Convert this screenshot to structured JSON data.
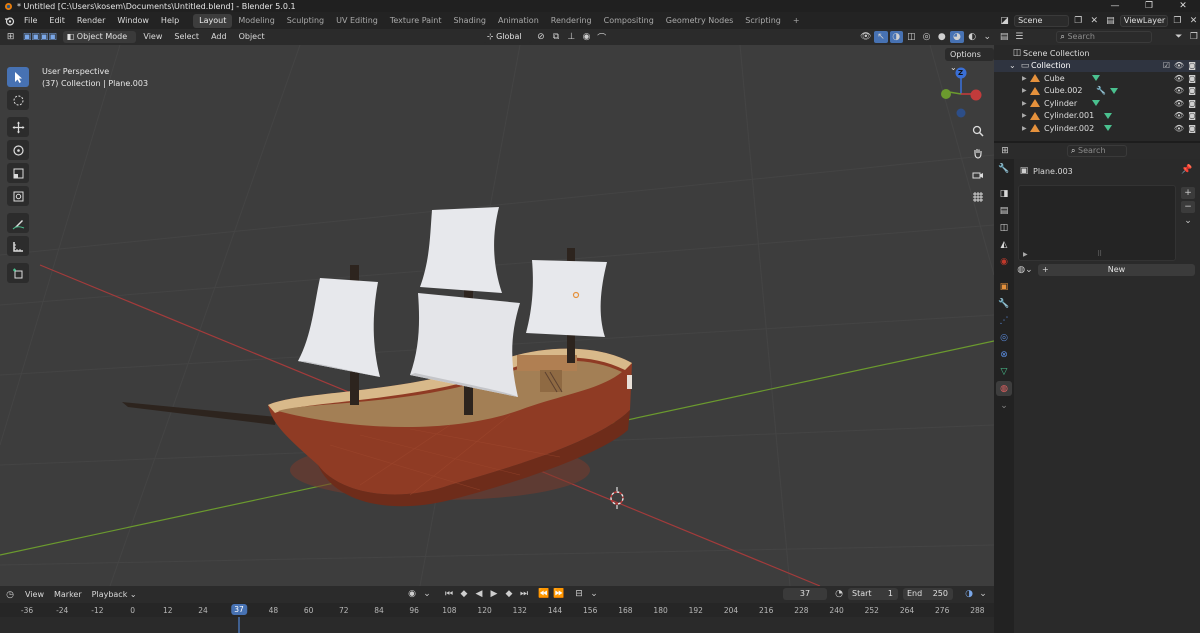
{
  "window": {
    "title": "* Untitled [C:\\Users\\kosem\\Documents\\Untitled.blend] - Blender 5.0.1",
    "controls": [
      "—",
      "❐",
      "✕"
    ]
  },
  "menu": [
    "File",
    "Edit",
    "Render",
    "Window",
    "Help"
  ],
  "workspaces": {
    "active": "Layout",
    "tabs": [
      "Layout",
      "Modeling",
      "Sculpting",
      "UV Editing",
      "Texture Paint",
      "Shading",
      "Animation",
      "Rendering",
      "Compositing",
      "Geometry Nodes",
      "Scripting"
    ],
    "add": "+"
  },
  "scene": {
    "name": "Scene",
    "view_layer": "ViewLayer"
  },
  "viewport_header": {
    "mode": "Object Mode",
    "menus": [
      "View",
      "Select",
      "Add",
      "Object"
    ],
    "orientation": "Global",
    "options_label": "Options"
  },
  "viewport": {
    "perspective": "User Perspective",
    "context": "(37) Collection | Plane.003",
    "gizmo_axis_z": "Z"
  },
  "timeline": {
    "menus": [
      "View",
      "Marker",
      "Playback"
    ],
    "current_frame": "37",
    "start_label": "Start",
    "start": "1",
    "end_label": "End",
    "end": "250",
    "ticks": [
      "-36",
      "-24",
      "-12",
      "0",
      "12",
      "24",
      "37",
      "48",
      "60",
      "72",
      "84",
      "96",
      "108",
      "120",
      "132",
      "144",
      "156",
      "168",
      "180",
      "192",
      "204",
      "216",
      "228",
      "240",
      "252",
      "264",
      "276",
      "288"
    ]
  },
  "outliner": {
    "search_placeholder": "Search",
    "scene_collection": "Scene Collection",
    "collection": "Collection",
    "items": [
      "Cube",
      "Cube.002",
      "Cylinder",
      "Cylinder.001",
      "Cylinder.002"
    ]
  },
  "properties": {
    "search_placeholder": "Search",
    "object_name": "Plane.003",
    "new_button": "New"
  },
  "colors": {
    "accent": "#4772b3",
    "object_orange": "#e5913c",
    "mesh_green": "#4ac18f",
    "grid_red": "#a33b3b",
    "grid_green": "#6b9a2e"
  }
}
